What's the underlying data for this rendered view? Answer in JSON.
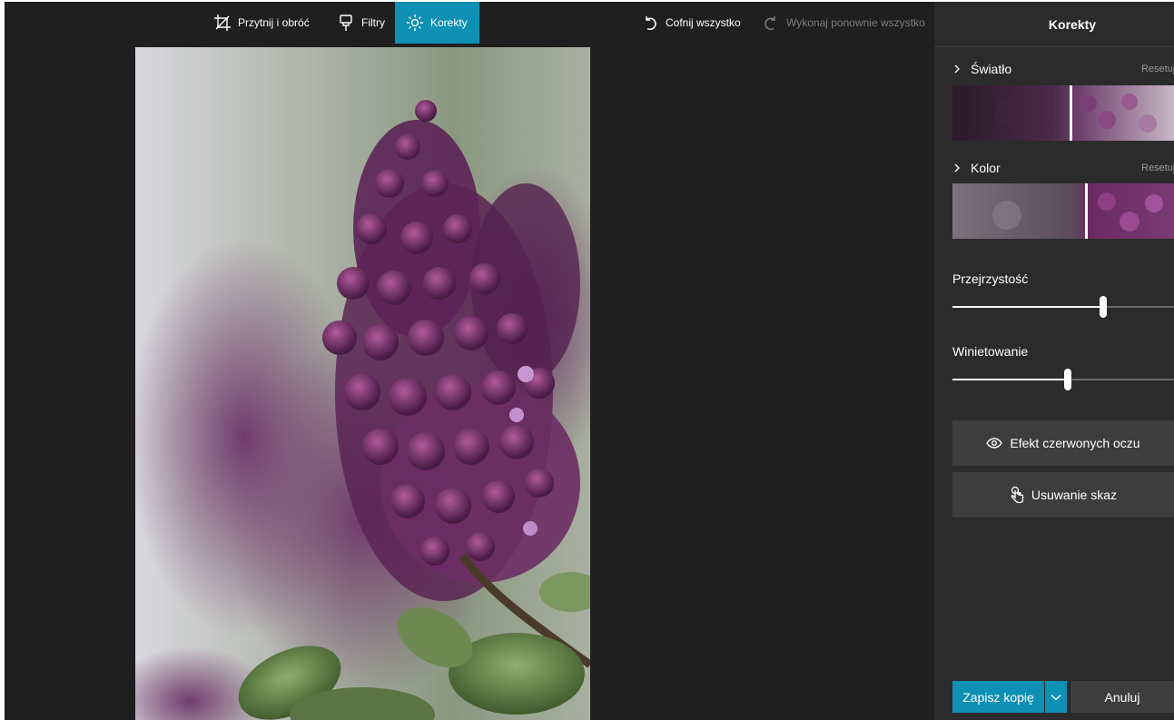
{
  "toolbar": {
    "crop_label": "Przytnij i obróć",
    "filters_label": "Filtry",
    "adjustments_label": "Korekty",
    "undo_all_label": "Cofnij wszystko",
    "redo_all_label": "Wykonaj ponownie wszystko"
  },
  "panel": {
    "title": "Korekty",
    "light": {
      "label": "Światło",
      "reset_label": "Resetuj",
      "handle_value": 0.53
    },
    "color": {
      "label": "Kolor",
      "reset_label": "Resetuj",
      "handle_value": 0.6
    },
    "clarity": {
      "label": "Przejrzystość",
      "value": 0.68
    },
    "vignette": {
      "label": "Winietowanie",
      "value": 0.52
    },
    "red_eye_label": "Efekt czerwonych oczu",
    "spot_fix_label": "Usuwanie skaz",
    "save_copy_label": "Zapisz kopię",
    "cancel_label": "Anuluj"
  },
  "icons": {
    "crop": "crop-icon",
    "filters": "filter-brush-icon",
    "adjustments": "sun-icon",
    "undo": "undo-icon",
    "redo": "redo-icon",
    "red_eye": "eye-icon",
    "spot_fix": "touch-hand-icon",
    "chevron": "chevron-right-icon",
    "dropdown": "chevron-down-icon"
  },
  "colors": {
    "accent": "#0e8fb4",
    "background": "#1f1f1f",
    "panel": "#2b2b2b",
    "button": "#3d3d3d"
  }
}
